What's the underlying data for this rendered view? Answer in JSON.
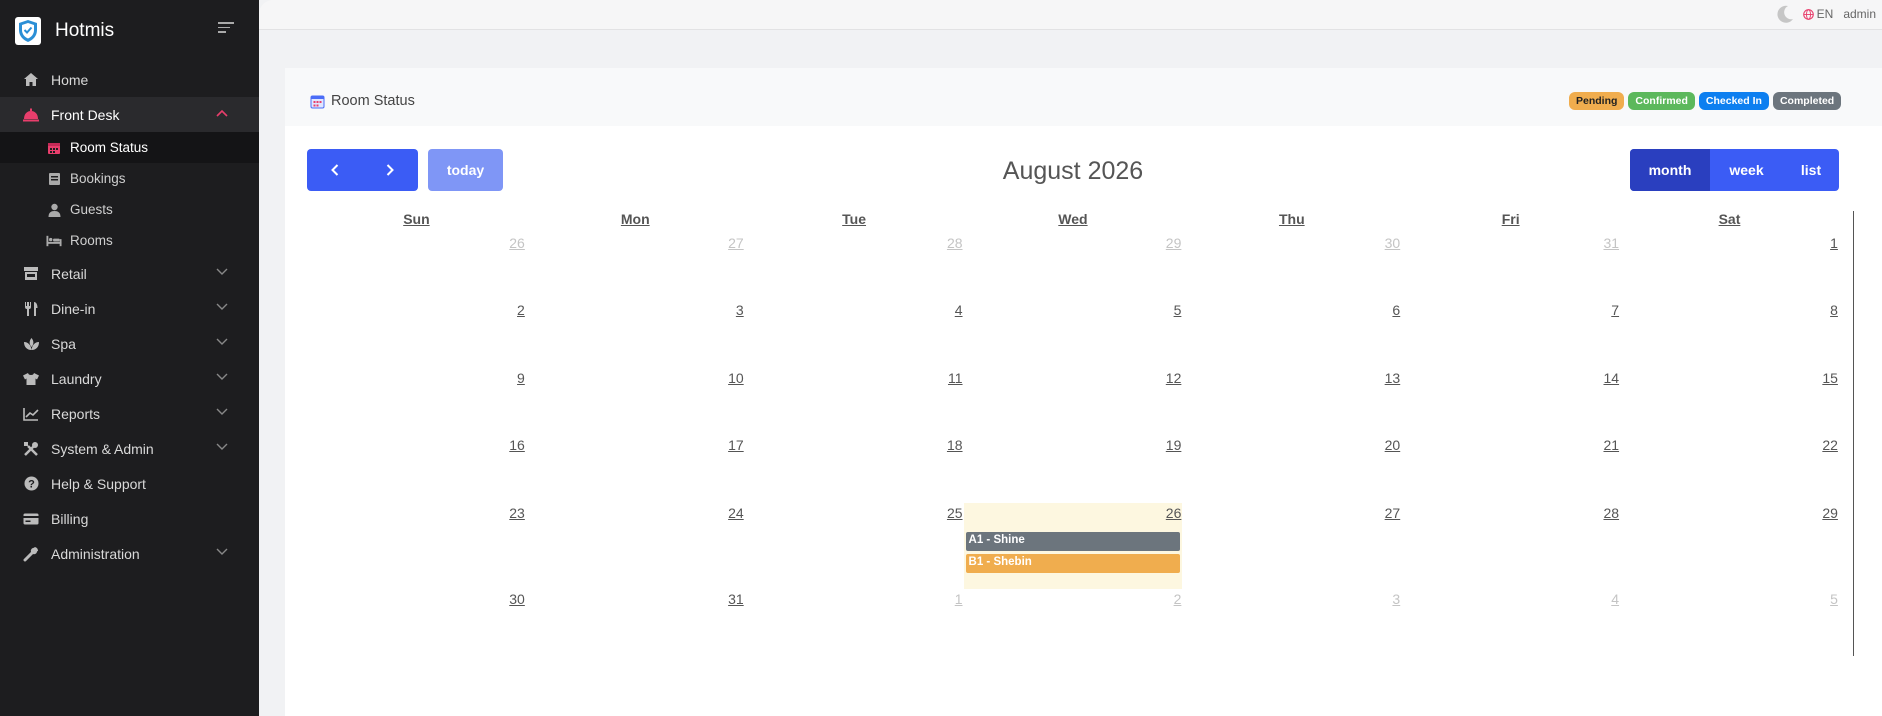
{
  "app": {
    "name": "Hotmis"
  },
  "topbar": {
    "lang": "EN",
    "user": "admin"
  },
  "sidebar": {
    "items": [
      {
        "label": "Home",
        "icon": "home-icon"
      },
      {
        "label": "Front Desk",
        "icon": "bell-icon"
      },
      {
        "label": "Retail",
        "icon": "store-icon"
      },
      {
        "label": "Dine-in",
        "icon": "utensils-icon"
      },
      {
        "label": "Spa",
        "icon": "spa-icon"
      },
      {
        "label": "Laundry",
        "icon": "shirt-icon"
      },
      {
        "label": "Reports",
        "icon": "chart-line-icon"
      },
      {
        "label": "System & Admin",
        "icon": "tools-icon"
      },
      {
        "label": "Help & Support",
        "icon": "question-icon"
      },
      {
        "label": "Billing",
        "icon": "card-icon"
      },
      {
        "label": "Administration",
        "icon": "wrench-icon"
      }
    ],
    "sub": [
      {
        "label": "Room Status",
        "icon": "calendar-icon"
      },
      {
        "label": "Bookings",
        "icon": "book-icon"
      },
      {
        "label": "Guests",
        "icon": "user-icon"
      },
      {
        "label": "Rooms",
        "icon": "bed-icon"
      }
    ]
  },
  "page": {
    "title": "Room Status",
    "legend": [
      "Pending",
      "Confirmed",
      "Checked In",
      "Completed"
    ]
  },
  "calendar": {
    "title": "August 2026",
    "today_label": "today",
    "views": [
      "month",
      "week",
      "list"
    ],
    "active_view": "month",
    "dow": [
      "Sun",
      "Mon",
      "Tue",
      "Wed",
      "Thu",
      "Fri",
      "Sat"
    ],
    "weeks": [
      [
        "26",
        "27",
        "28",
        "29",
        "30",
        "31",
        "1"
      ],
      [
        "2",
        "3",
        "4",
        "5",
        "6",
        "7",
        "8"
      ],
      [
        "9",
        "10",
        "11",
        "12",
        "13",
        "14",
        "15"
      ],
      [
        "16",
        "17",
        "18",
        "19",
        "20",
        "21",
        "22"
      ],
      [
        "23",
        "24",
        "25",
        "26",
        "27",
        "28",
        "29"
      ],
      [
        "30",
        "31",
        "1",
        "2",
        "3",
        "4",
        "5"
      ]
    ],
    "events": [
      {
        "label": "A1 - Shine",
        "status": "Completed"
      },
      {
        "label": "B1 - Shebin",
        "status": "Pending"
      }
    ]
  },
  "colors": {
    "primary": "#3b5cf5",
    "pending": "#f0ad4e",
    "confirmed": "#5cb85c",
    "checked_in": "#0d7ff0",
    "completed": "#6c757d",
    "accent": "#e83e6c"
  }
}
